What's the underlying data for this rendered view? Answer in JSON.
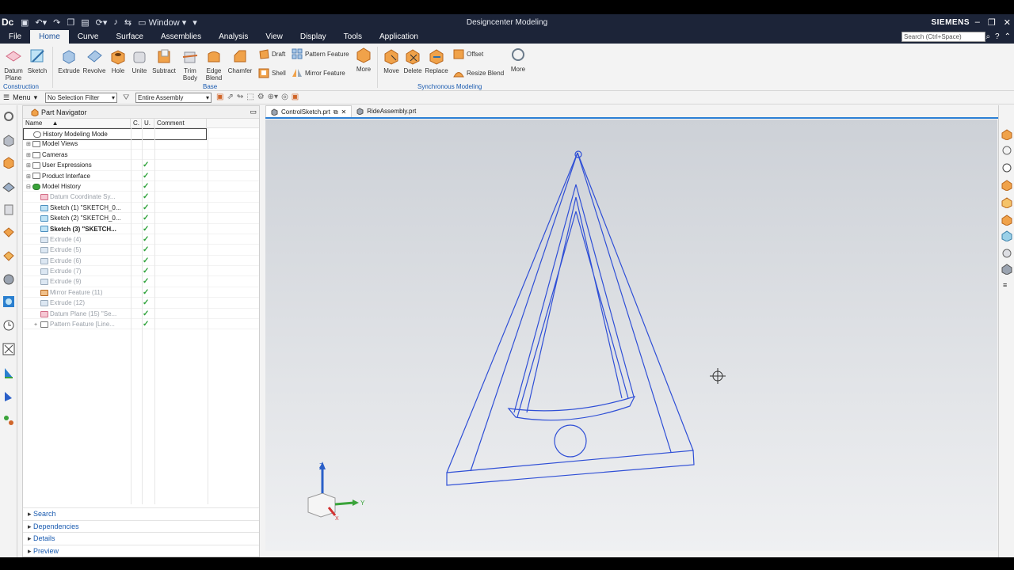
{
  "titlebar": {
    "logo": "Dc",
    "window_label": "Window",
    "title": "Designcenter Modeling",
    "brand": "SIEMENS"
  },
  "menubar": {
    "items": [
      "File",
      "Home",
      "Curve",
      "Surface",
      "Assemblies",
      "Analysis",
      "View",
      "Display",
      "Tools",
      "Application"
    ],
    "active": "Home",
    "search_placeholder": "Search (Ctrl+Space)"
  },
  "ribbon": {
    "construction": {
      "label": "Construction",
      "datum_plane": "Datum Plane",
      "sketch": "Sketch"
    },
    "base": {
      "label": "Base",
      "extrude": "Extrude",
      "revolve": "Revolve",
      "hole": "Hole",
      "unite": "Unite",
      "subtract": "Subtract",
      "trim_body": "Trim Body",
      "edge_blend": "Edge Blend",
      "chamfer": "Chamfer",
      "draft": "Draft",
      "shell": "Shell",
      "pattern_feature": "Pattern Feature",
      "mirror_feature": "Mirror Feature",
      "more": "More"
    },
    "sync": {
      "label": "Synchronous Modeling",
      "move": "Move",
      "delete": "Delete",
      "replace": "Replace",
      "offset": "Offset",
      "resize_blend": "Resize Blend",
      "more": "More"
    }
  },
  "selection_bar": {
    "menu_label": "Menu",
    "selection_filter": "No Selection Filter",
    "scope": "Entire Assembly"
  },
  "navigator": {
    "title": "Part Navigator",
    "columns": {
      "name": "Name",
      "c": "C.",
      "u": "U.",
      "comment": "Comment"
    },
    "rows": [
      {
        "label": "History Modeling Mode",
        "check": "",
        "indent": 0,
        "style": "normal",
        "icon": "clock-icon"
      },
      {
        "label": "Model Views",
        "check": "",
        "indent": 0,
        "style": "normal",
        "icon": "folder-icon"
      },
      {
        "label": "Cameras",
        "check": "",
        "indent": 0,
        "style": "normal",
        "icon": "camera-icon"
      },
      {
        "label": "User Expressions",
        "check": "✓",
        "indent": 0,
        "style": "normal",
        "icon": "folder-icon"
      },
      {
        "label": "Product Interface",
        "check": "✓",
        "indent": 0,
        "style": "normal",
        "icon": "folder-icon"
      },
      {
        "label": "Model History",
        "check": "✓",
        "indent": 0,
        "style": "normal",
        "icon": "history-icon"
      },
      {
        "label": "Datum Coordinate Sy...",
        "check": "✓",
        "indent": 1,
        "style": "dim",
        "icon": "datum-csys-icon"
      },
      {
        "label": "Sketch (1) \"SKETCH_0...",
        "check": "✓",
        "indent": 1,
        "style": "normal",
        "icon": "sketch-icon"
      },
      {
        "label": "Sketch (2) \"SKETCH_0...",
        "check": "✓",
        "indent": 1,
        "style": "normal",
        "icon": "sketch-icon"
      },
      {
        "label": "Sketch (3) \"SKETCH...",
        "check": "✓",
        "indent": 1,
        "style": "bold",
        "icon": "sketch-icon"
      },
      {
        "label": "Extrude (4)",
        "check": "✓",
        "indent": 1,
        "style": "dim",
        "icon": "extrude-icon"
      },
      {
        "label": "Extrude (5)",
        "check": "✓",
        "indent": 1,
        "style": "dim",
        "icon": "extrude-icon"
      },
      {
        "label": "Extrude (6)",
        "check": "✓",
        "indent": 1,
        "style": "dim",
        "icon": "extrude-icon"
      },
      {
        "label": "Extrude (7)",
        "check": "✓",
        "indent": 1,
        "style": "dim",
        "icon": "extrude-icon"
      },
      {
        "label": "Extrude (9)",
        "check": "✓",
        "indent": 1,
        "style": "dim",
        "icon": "extrude-icon"
      },
      {
        "label": "Mirror Feature (11)",
        "check": "✓",
        "indent": 1,
        "style": "dim",
        "icon": "mirror-icon"
      },
      {
        "label": "Extrude (12)",
        "check": "✓",
        "indent": 1,
        "style": "dim",
        "icon": "extrude-icon"
      },
      {
        "label": "Datum Plane (15) \"Se...",
        "check": "✓",
        "indent": 1,
        "style": "dim",
        "icon": "datum-plane-icon"
      },
      {
        "label": "Pattern Feature [Line...",
        "check": "✓",
        "indent": 1,
        "style": "dim",
        "icon": "pattern-icon"
      }
    ],
    "panels": [
      "Search",
      "Dependencies",
      "Details",
      "Preview"
    ]
  },
  "tabs": [
    "ControlSketch.prt",
    "RideAssembly.prt"
  ],
  "viewport": {
    "triad": {
      "z": "Z",
      "y": "Y",
      "x": "X"
    },
    "colors": {
      "wire": "#2f4fd6",
      "z": "#2a5fc8",
      "y": "#3aa33a",
      "x": "#d23030"
    }
  }
}
